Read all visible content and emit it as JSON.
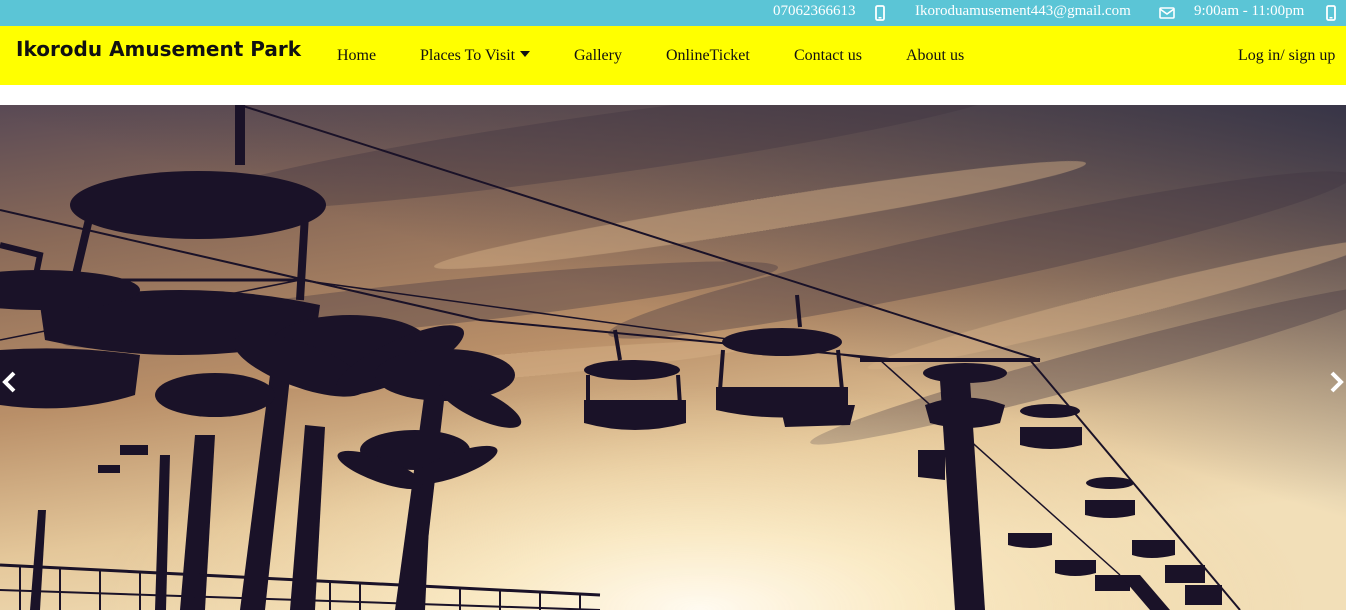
{
  "topbar": {
    "phone": "07062366613",
    "email": "Ikoroduamusement443@gmail.com",
    "hours": "9:00am - 11:00pm"
  },
  "icons": {
    "phone": "mobile-phone-icon",
    "email": "envelope-icon",
    "hours": "mobile-phone-icon",
    "carousel_prev": "chevron-left-icon",
    "carousel_next": "chevron-right-icon",
    "dropdown": "caret-down-icon"
  },
  "brand": "Ikorodu Amusement Park",
  "nav": {
    "home": "Home",
    "places": "Places To Visit",
    "gallery": "Gallery",
    "online_ticket": "OnlineTicket",
    "contact": "Contact us",
    "about": "About us",
    "login": "Log in/ sign up"
  },
  "colors": {
    "topbar_bg": "#5bc5d6",
    "navbar_bg": "#ffff00",
    "text": "#111111",
    "topbar_text": "#ffffff"
  }
}
